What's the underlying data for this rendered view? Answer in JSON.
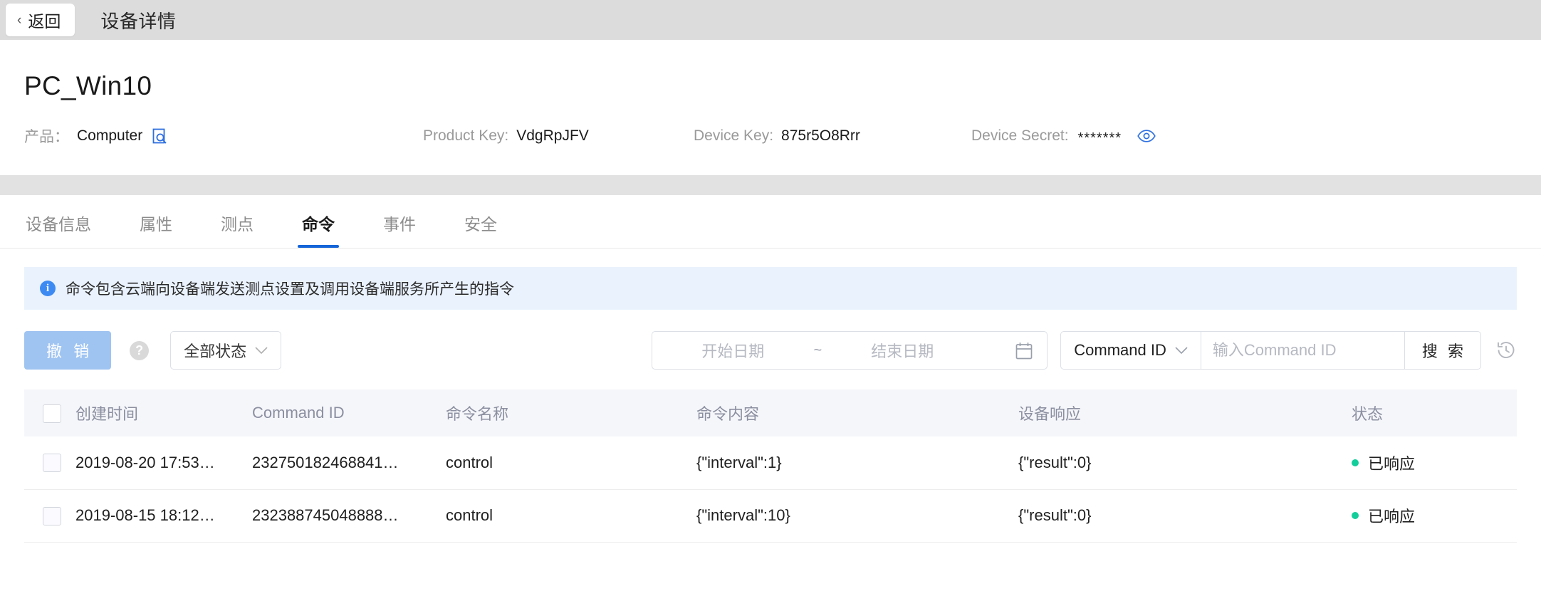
{
  "topbar": {
    "back_label": "返回",
    "back_chevron": "‹",
    "title": "设备详情"
  },
  "device": {
    "name": "PC_Win10",
    "product_label": "产品：",
    "product_value": "Computer",
    "product_icon": "product-search-icon",
    "product_key_label": "Product Key:",
    "product_key_value": "VdgRpJFV",
    "device_key_label": "Device Key:",
    "device_key_value": "875r5O8Rrr",
    "device_secret_label": "Device Secret:",
    "device_secret_value": "*******",
    "secret_toggle_icon": "eye-icon"
  },
  "tabs": [
    {
      "label": "设备信息",
      "active": false
    },
    {
      "label": "属性",
      "active": false
    },
    {
      "label": "测点",
      "active": false
    },
    {
      "label": "命令",
      "active": true
    },
    {
      "label": "事件",
      "active": false
    },
    {
      "label": "安全",
      "active": false
    }
  ],
  "banner": {
    "icon": "info-icon",
    "text": "命令包含云端向设备端发送测点设置及调用设备端服务所产生的指令"
  },
  "toolbar": {
    "cancel_label": "撤 销",
    "help_icon_glyph": "?",
    "status_filter_value": "全部状态",
    "caret_glyph": "⌄",
    "date_start_placeholder": "开始日期",
    "date_separator": "~",
    "date_end_placeholder": "结束日期",
    "calendar_icon": "calendar-icon",
    "search_field_label": "Command ID",
    "search_input_placeholder": "输入Command ID",
    "search_input_value": "",
    "search_button_label": "搜 索",
    "history_icon": "history-icon"
  },
  "table": {
    "columns": [
      {
        "key": "check",
        "label": ""
      },
      {
        "key": "time",
        "label": "创建时间"
      },
      {
        "key": "cmdid",
        "label": "Command ID"
      },
      {
        "key": "name",
        "label": "命令名称"
      },
      {
        "key": "body",
        "label": "命令内容"
      },
      {
        "key": "resp",
        "label": "设备响应"
      },
      {
        "key": "state",
        "label": "状态"
      }
    ],
    "rows": [
      {
        "time": "2019-08-20 17:53…",
        "cmdid": "232750182468841…",
        "name": "control",
        "body": "{\"interval\":1}",
        "resp": "{\"result\":0}",
        "state": "已响应",
        "state_color": "#13ce9b"
      },
      {
        "time": "2019-08-15 18:12…",
        "cmdid": "232388745048888…",
        "name": "control",
        "body": "{\"interval\":10}",
        "resp": "{\"result\":0}",
        "state": "已响应",
        "state_color": "#13ce9b"
      }
    ]
  },
  "colors": {
    "accent": "#1565d8",
    "banner_bg": "#eaf2fd",
    "success": "#13ce9b",
    "primary_disabled": "#9fc4f2"
  }
}
